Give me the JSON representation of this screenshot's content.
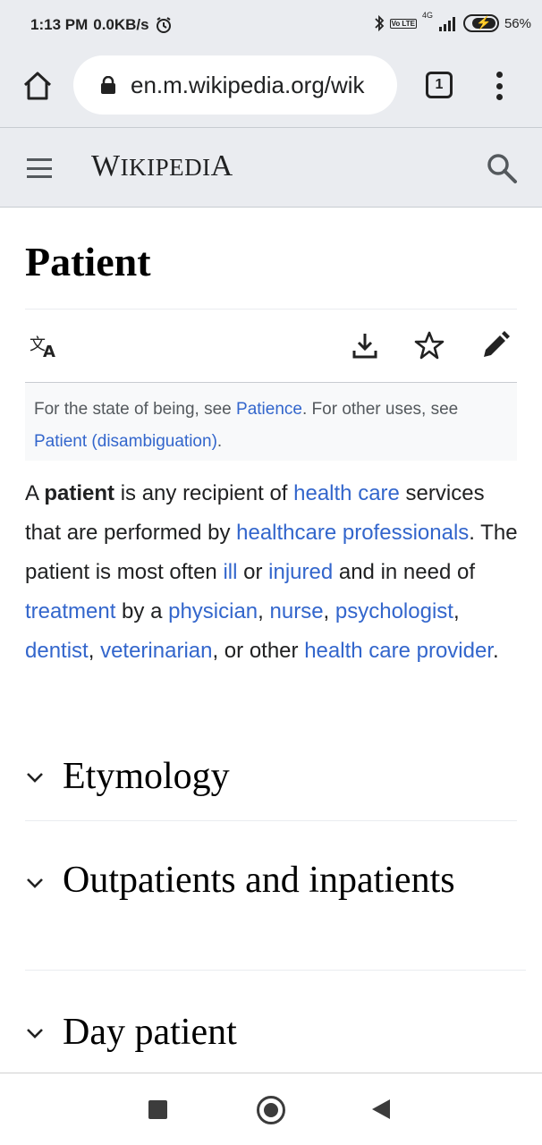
{
  "status_bar": {
    "time": "1:13 PM",
    "net_speed": "0.0KB/s",
    "volte": "Vo LTE",
    "network": "4G",
    "battery": "56%",
    "icons": [
      "alarm-icon",
      "bluetooth-icon",
      "signal-icon",
      "battery-charging-icon"
    ]
  },
  "browser": {
    "url": "en.m.wikipedia.org/wik",
    "tab_count": "1",
    "icons": [
      "home-icon",
      "lock-icon",
      "more-menu-icon"
    ]
  },
  "wiki_header": {
    "logo_first": "W",
    "logo_rest": "IKIPEDI",
    "logo_last": "A",
    "icons": [
      "hamburger-menu-icon",
      "search-icon"
    ]
  },
  "article": {
    "title": "Patient",
    "toolbar_icons": [
      "language-icon",
      "download-icon",
      "star-icon",
      "edit-icon"
    ],
    "hatnote": {
      "t1": "For the state of being, see ",
      "link1": "Patience",
      "t2": ". For other uses, see ",
      "link2": "Patient (disambiguation)",
      "t3": "."
    },
    "lead": {
      "t1": "A ",
      "bold": "patient",
      "t2": " is any recipient of ",
      "l1": "health care",
      "t3": " services that are performed by ",
      "l2": "healthcare professionals",
      "t4": ". The patient is most often ",
      "l3": "ill",
      "t5": " or ",
      "l4": "injured",
      "t6": " and in need of ",
      "l5": "treatment",
      "t7": " by a ",
      "l6": "physician",
      "t8": ", ",
      "l7": "nurse",
      "t9": ", ",
      "l8": "psychologist",
      "t10": ", ",
      "l9": "dentist",
      "t11": ", ",
      "l10": "veterinarian",
      "t12": ", or other ",
      "l11": "health care provider",
      "t13": "."
    },
    "sections": [
      {
        "title": "Etymology"
      },
      {
        "title": "Outpatients and inpatients"
      },
      {
        "title": "Day patient"
      }
    ]
  },
  "nav_bar": {
    "icons": [
      "recents-icon",
      "home-nav-icon",
      "back-icon"
    ]
  },
  "colors": {
    "link": "#3366cc",
    "chrome_bg": "#eaecf0",
    "text": "#202122"
  }
}
